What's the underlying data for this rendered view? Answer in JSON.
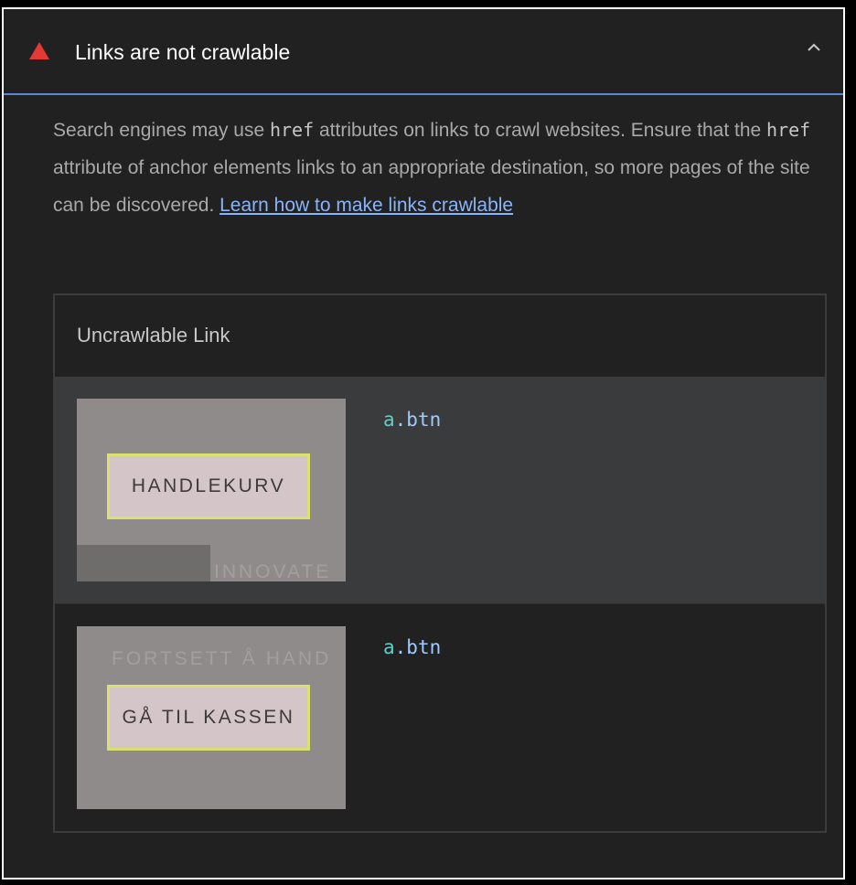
{
  "audit": {
    "title": "Links are not crawlable",
    "icons": {
      "status": "warning-triangle-icon",
      "toggle": "chevron-up-icon"
    },
    "colors": {
      "warning": "#e53935",
      "accent_line": "#5b86d3",
      "link": "#8ab4f8",
      "highlight_border": "#d8e26a"
    },
    "description": {
      "part1": "Search engines may use ",
      "code1": "href",
      "part2": " attributes on links to crawl websites. Ensure that the ",
      "code2": "href",
      "part3": " attribute of anchor elements links to an appropriate destination, so more pages of the site can be discovered. ",
      "link_text": "Learn how to make links crawlable"
    }
  },
  "table": {
    "column_header": "Uncrawlable Link",
    "rows": [
      {
        "selector_tag": "a",
        "selector_class": ".btn",
        "thumb_label": "HANDLEKURV",
        "thumb_faint_text": "INNOVATE"
      },
      {
        "selector_tag": "a",
        "selector_class": ".btn",
        "thumb_label": "GÅ TIL KASSEN",
        "thumb_faint_text": "FORTSETT Å HAND"
      }
    ]
  }
}
